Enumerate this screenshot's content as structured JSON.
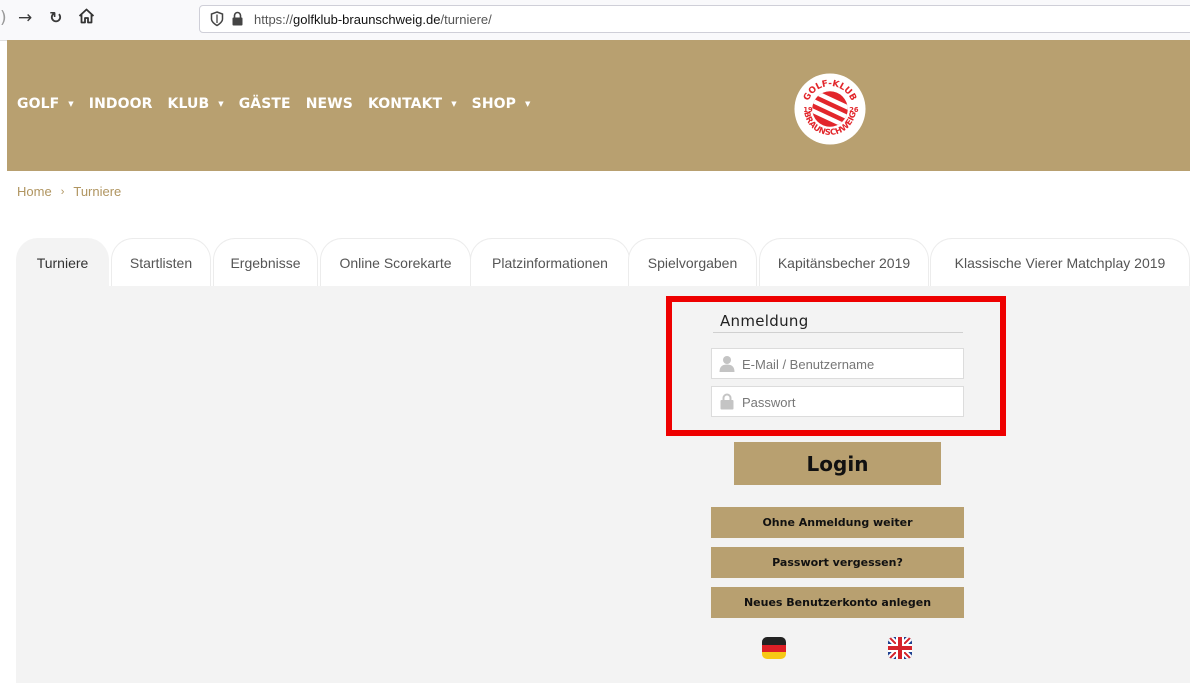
{
  "browser": {
    "url_prefix": "https://",
    "url_host": "golfklub-braunschweig.de",
    "url_path": "/turniere/"
  },
  "nav": {
    "items": [
      {
        "label": "GOLF",
        "has_dropdown": true
      },
      {
        "label": "INDOOR",
        "has_dropdown": false
      },
      {
        "label": "KLUB",
        "has_dropdown": true
      },
      {
        "label": "GÄSTE",
        "has_dropdown": false
      },
      {
        "label": "NEWS",
        "has_dropdown": false
      },
      {
        "label": "KONTAKT",
        "has_dropdown": true
      },
      {
        "label": "SHOP",
        "has_dropdown": true
      }
    ],
    "caret": "▼"
  },
  "logo": {
    "top_text": "GOLF-KLUB",
    "bottom_text": "BRAUNSCHWEIG",
    "year_left": "19",
    "year_right": "26"
  },
  "breadcrumb": {
    "home": "Home",
    "separator": "›",
    "current": "Turniere"
  },
  "tabs": [
    {
      "label": "Turniere",
      "active": true
    },
    {
      "label": "Startlisten",
      "active": false
    },
    {
      "label": "Ergebnisse",
      "active": false
    },
    {
      "label": "Online Scorekarte",
      "active": false
    },
    {
      "label": "Platzinformationen",
      "active": false
    },
    {
      "label": "Spielvorgaben",
      "active": false
    },
    {
      "label": "Kapitänsbecher 2019",
      "active": false
    },
    {
      "label": "Klassische Vierer Matchplay 2019",
      "active": false
    }
  ],
  "login": {
    "title": "Anmeldung",
    "username_placeholder": "E-Mail / Benutzername",
    "password_placeholder": "Passwort",
    "login_button": "Login",
    "continue_button": "Ohne Anmeldung weiter",
    "forgot_button": "Passwort vergessen?",
    "register_button": "Neues Benutzerkonto anlegen"
  },
  "languages": [
    {
      "code": "de",
      "icon": "german-flag-icon"
    },
    {
      "code": "en",
      "icon": "uk-flag-icon"
    }
  ],
  "colors": {
    "brand_gold": "#b8a070",
    "breadcrumb_link": "#b09560",
    "highlight_red": "#ee0000",
    "logo_red": "#e2262b"
  }
}
